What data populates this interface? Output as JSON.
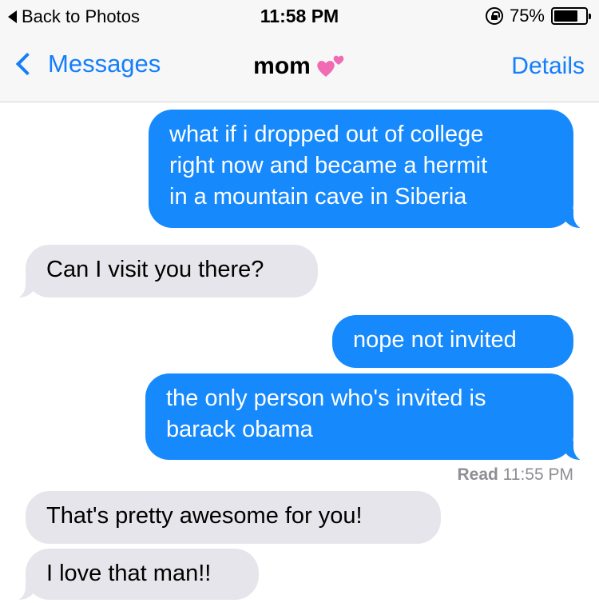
{
  "status_bar": {
    "back_label": "Back to Photos",
    "time": "11:58 PM",
    "battery": "75%",
    "battery_level": 0.75
  },
  "nav": {
    "back_label": "Messages",
    "title": "mom",
    "title_emoji": "two-hearts",
    "details_label": "Details"
  },
  "messages": [
    {
      "from": "me",
      "lines": [
        "what if i dropped out of college",
        "right now and became a hermit",
        "in a mountain cave in Siberia"
      ]
    },
    {
      "from": "mom",
      "lines": [
        "Can I visit you there?"
      ]
    },
    {
      "from": "me",
      "lines": [
        "nope not invited"
      ]
    },
    {
      "from": "me",
      "lines": [
        "the only person who's invited is",
        "barack obama"
      ]
    },
    {
      "from": "mom",
      "lines": [
        "That's pretty awesome for you!"
      ]
    },
    {
      "from": "mom",
      "lines": [
        "I love that man!!"
      ]
    }
  ],
  "read_receipt": {
    "label": "Read",
    "time": "11:55 PM"
  },
  "colors": {
    "accent": "#147efb",
    "outgoing": "#1689fc",
    "incoming": "#e6e5eb"
  }
}
